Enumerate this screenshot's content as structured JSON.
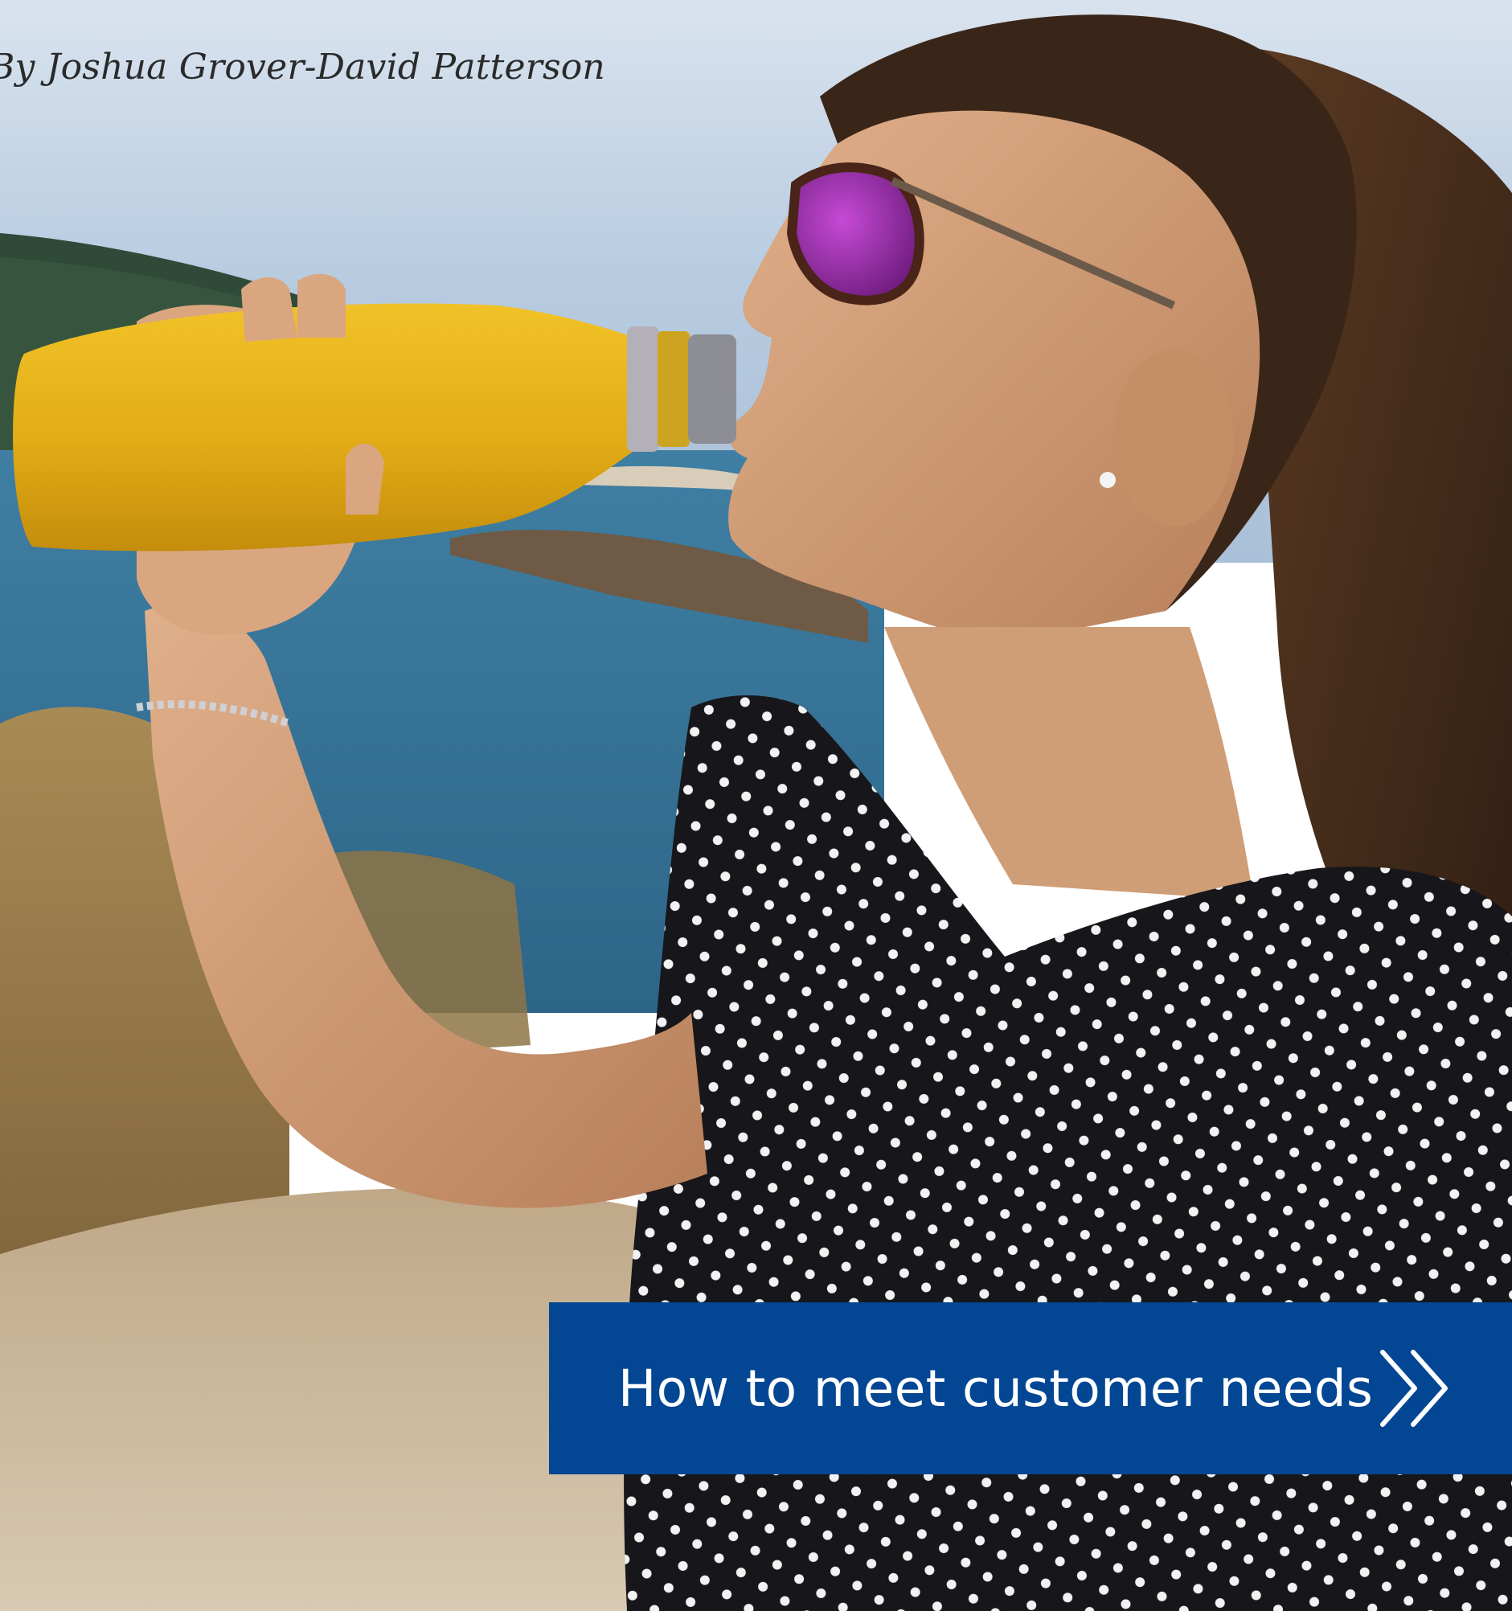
{
  "article": {
    "byline": "By Joshua Grover-David Patterson"
  },
  "photo": {
    "subject": "woman-drinking-from-yellow-bottle"
  },
  "cta": {
    "label": "How to meet customer needs",
    "icon": "double-chevron-right-icon",
    "background_color": "#034693",
    "text_color": "#ffffff"
  }
}
